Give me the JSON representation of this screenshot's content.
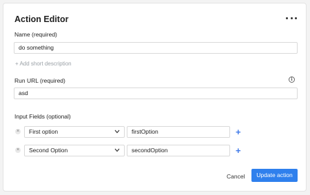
{
  "editor": {
    "title": "Action Editor",
    "name_label": "Name (required)",
    "name_value": "do something",
    "add_description": "+ Add short description",
    "url_label": "Run URL (required)",
    "url_value": "asd",
    "input_fields_label": "Input Fields (optional)"
  },
  "input_fields": [
    {
      "option": "First option",
      "value": "firstOption"
    },
    {
      "option": "Second Option",
      "value": "secondOption"
    }
  ],
  "actions": {
    "cancel": "Cancel",
    "update": "Update action"
  },
  "icons": {
    "more": "more-horizontal-icon",
    "info": "info-icon",
    "remove": "remove-icon",
    "chevron": "chevron-down-icon",
    "add": "add-icon"
  },
  "colors": {
    "accent": "#2f80ed",
    "plus": "#3f79e8"
  }
}
